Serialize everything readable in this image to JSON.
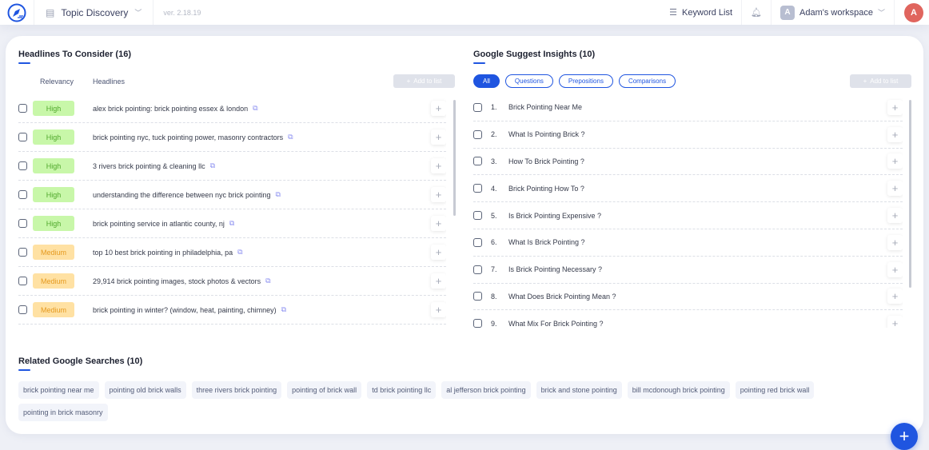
{
  "header": {
    "tool": "Topic Discovery",
    "version": "ver. 2.18.19",
    "keyword_list": "Keyword List",
    "workspace_initial": "A",
    "workspace": "Adam's workspace",
    "avatar_initial": "A"
  },
  "headlines": {
    "title": "Headlines To Consider (16)",
    "col_relevancy": "Relevancy",
    "col_headlines": "Headlines",
    "add_to_list": "Add to list",
    "items": [
      {
        "relevancy": "High",
        "text": "alex brick pointing: brick pointing essex & london"
      },
      {
        "relevancy": "High",
        "text": "brick pointing nyc, tuck pointing power, masonry contractors"
      },
      {
        "relevancy": "High",
        "text": "3 rivers brick pointing & cleaning llc"
      },
      {
        "relevancy": "High",
        "text": "understanding the difference between nyc brick pointing"
      },
      {
        "relevancy": "High",
        "text": "brick pointing service in atlantic county, nj"
      },
      {
        "relevancy": "Medium",
        "text": "top 10 best brick pointing in philadelphia, pa"
      },
      {
        "relevancy": "Medium",
        "text": "29,914 brick pointing images, stock photos & vectors"
      },
      {
        "relevancy": "Medium",
        "text": "brick pointing in winter? (window, heat, painting, chimney)"
      },
      {
        "relevancy": "Medium",
        "text": ""
      }
    ]
  },
  "suggest": {
    "title": "Google Suggest Insights (10)",
    "add_to_list": "Add to list",
    "filters": [
      "All",
      "Questions",
      "Prepositions",
      "Comparisons"
    ],
    "active_filter": "All",
    "items": [
      {
        "num": "1.",
        "text": "Brick Pointing Near Me"
      },
      {
        "num": "2.",
        "text": "What Is Pointing Brick ?"
      },
      {
        "num": "3.",
        "text": "How To Brick Pointing ?"
      },
      {
        "num": "4.",
        "text": "Brick Pointing How To ?"
      },
      {
        "num": "5.",
        "text": "Is Brick Pointing Expensive ?"
      },
      {
        "num": "6.",
        "text": "What Is Brick Pointing ?"
      },
      {
        "num": "7.",
        "text": "Is Brick Pointing Necessary ?"
      },
      {
        "num": "8.",
        "text": "What Does Brick Pointing Mean ?"
      },
      {
        "num": "9.",
        "text": "What Mix For Brick Pointing ?"
      }
    ]
  },
  "related": {
    "title": "Related Google Searches (10)",
    "items": [
      "brick pointing near me",
      "pointing old brick walls",
      "three rivers brick pointing",
      "pointing of brick wall",
      "td brick pointing llc",
      "al jefferson brick pointing",
      "brick and stone pointing",
      "bill mcdonough brick pointing",
      "pointing red brick wall",
      "pointing in brick masonry"
    ]
  },
  "fab": "+"
}
